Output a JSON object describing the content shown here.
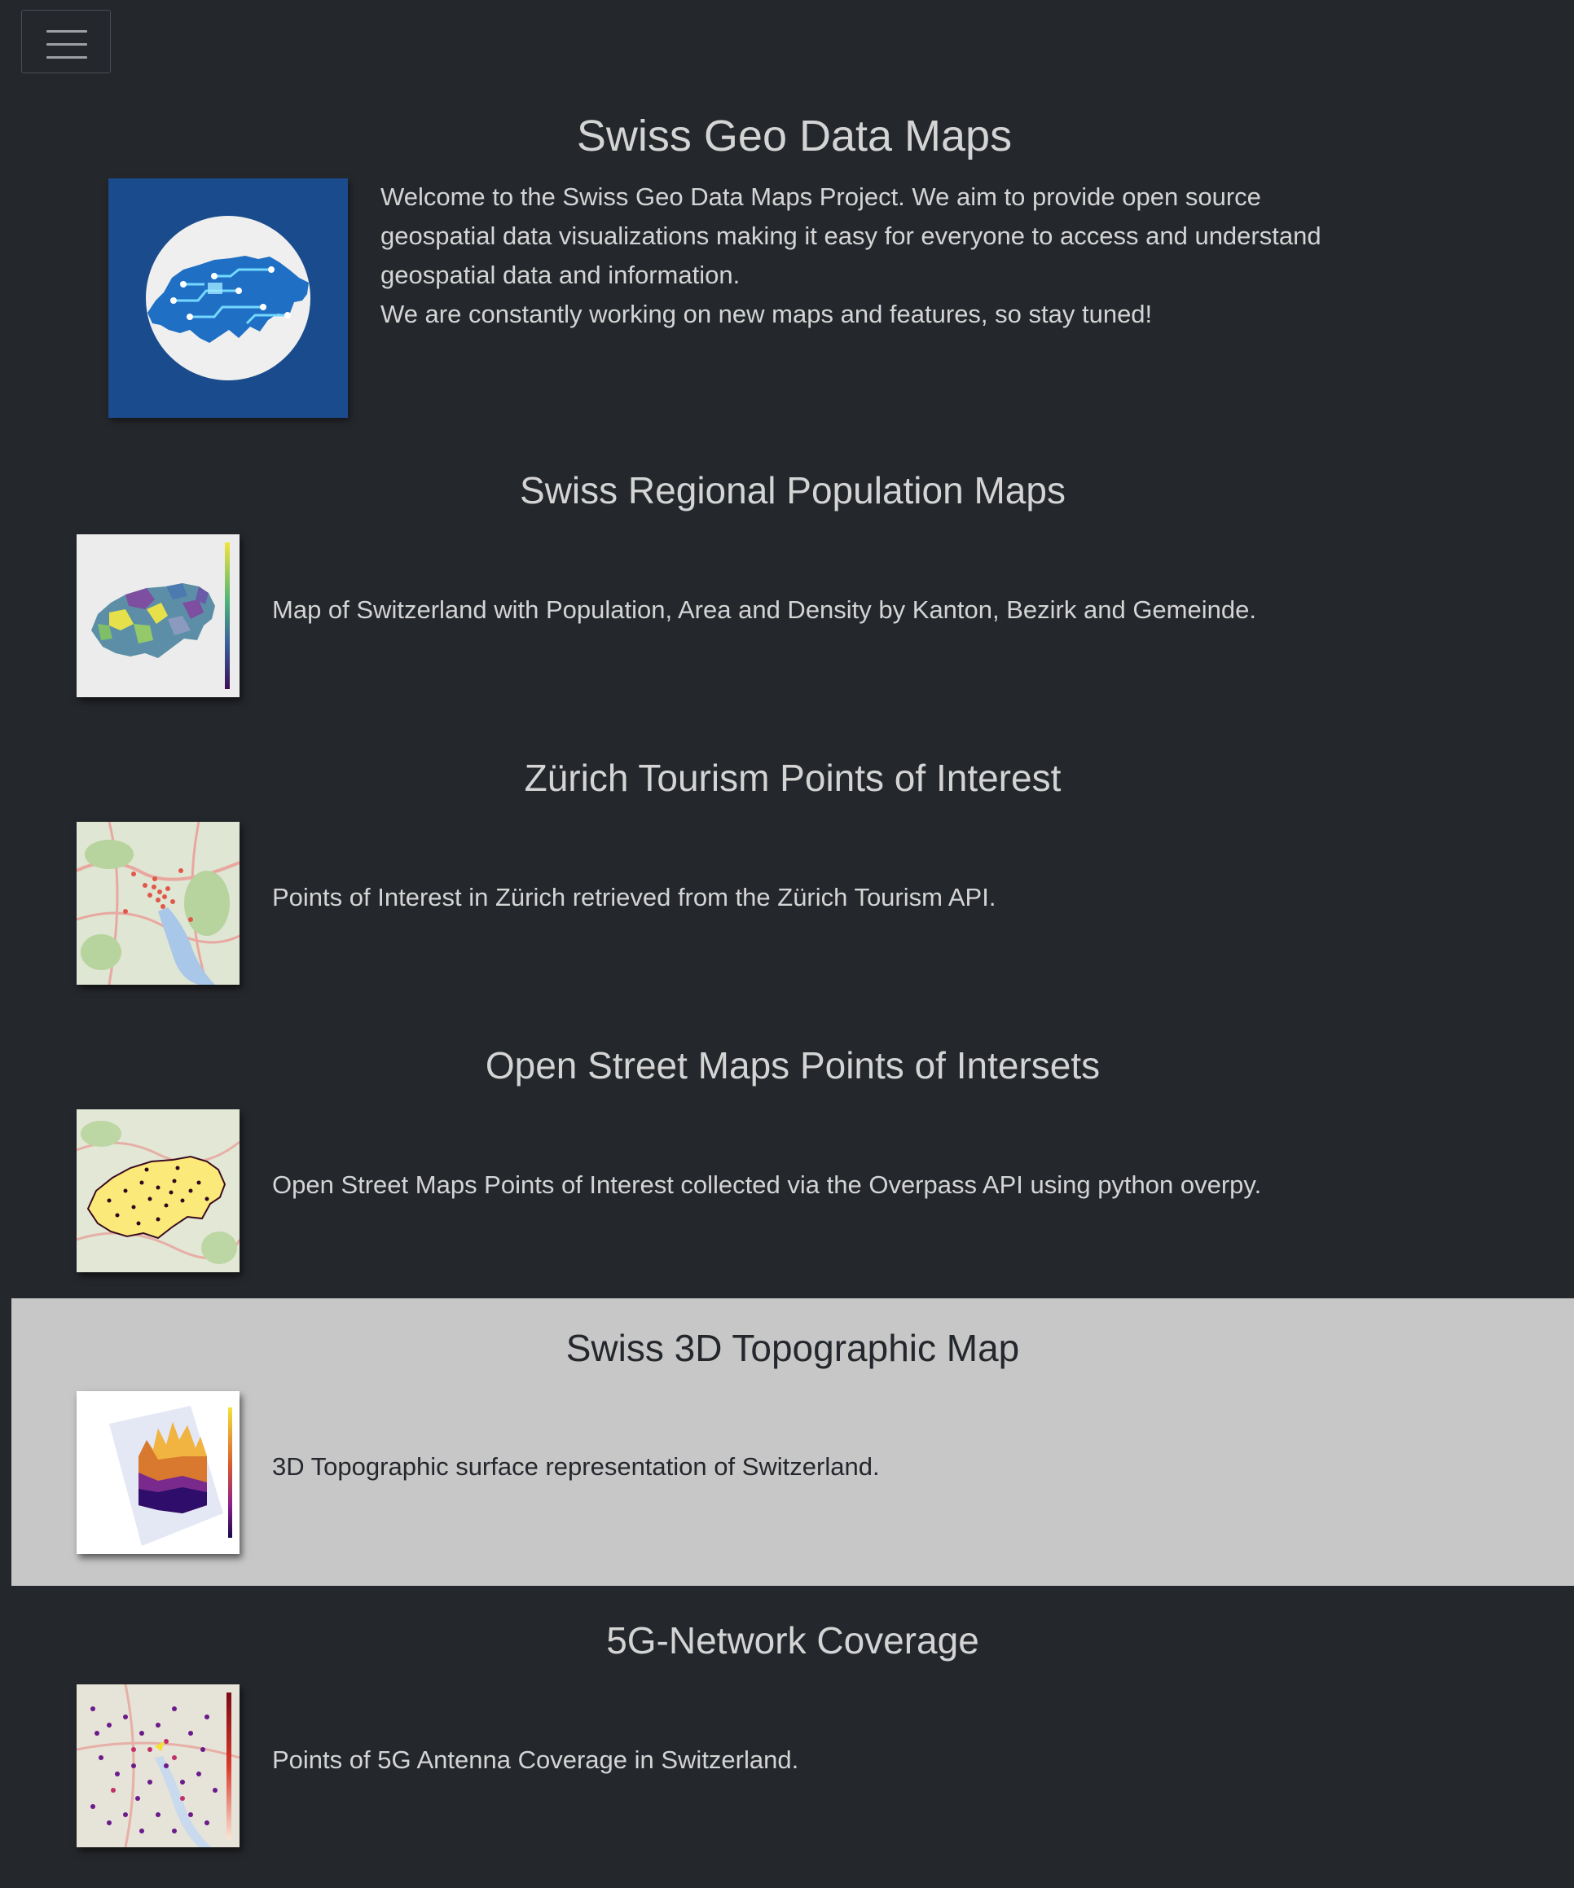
{
  "header": {
    "menu_icon": "hamburger-menu-icon"
  },
  "hero": {
    "title": "Swiss Geo Data Maps",
    "logo_icon": "swiss-circuit-map-logo",
    "paragraphs": [
      "Welcome to the Swiss Geo Data Maps Project. We aim to provide open source geospatial data visualizations making it easy for everyone to access and understand geospatial data and information.",
      "We are constantly working on new maps and features, so stay tuned!"
    ]
  },
  "sections": [
    {
      "title": "Swiss Regional Population Maps",
      "description": "Map of Switzerland with Population, Area and Density by Kanton, Bezirk and Gemeinde.",
      "thumbnail_icon": "population-choropleth-thumbnail"
    },
    {
      "title": "Zürich Tourism Points of Interest",
      "description": "Points of Interest in Zürich retrieved from the Zürich Tourism API.",
      "thumbnail_icon": "zurich-poi-map-thumbnail"
    },
    {
      "title": "Open Street Maps Points of Intersets",
      "description": "Open Street Maps Points of Interest collected via the Overpass API using python overpy.",
      "thumbnail_icon": "osm-poi-map-thumbnail"
    },
    {
      "title": "Swiss 3D Topographic Map",
      "description": "3D Topographic surface representation of Switzerland.",
      "thumbnail_icon": "3d-topographic-surface-thumbnail",
      "highlighted": true
    },
    {
      "title": "5G-Network Coverage",
      "description": "Points of 5G Antenna Coverage in Switzerland.",
      "thumbnail_icon": "5g-coverage-map-thumbnail"
    }
  ],
  "colors": {
    "background": "#24272c",
    "text": "#d4d4d4",
    "highlight_background": "#c7c7c7",
    "logo_blue": "#1a4b8c"
  }
}
